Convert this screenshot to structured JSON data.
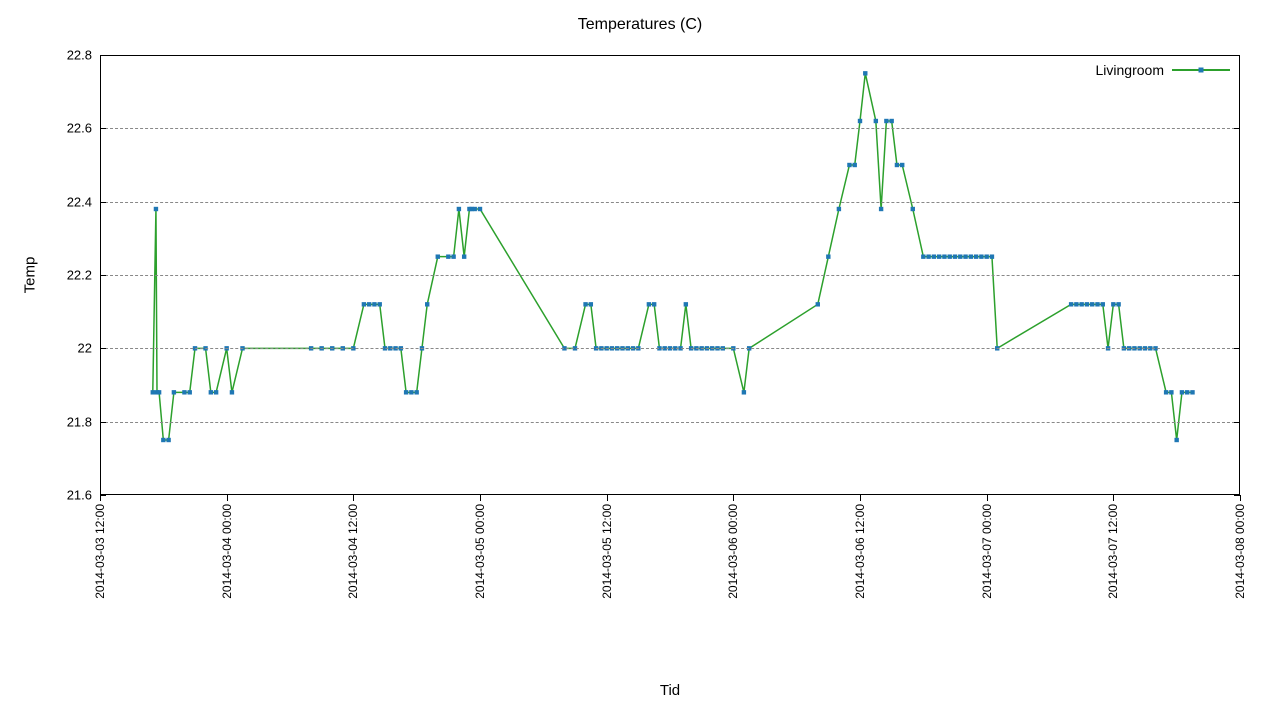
{
  "chart_data": {
    "type": "line",
    "title": "Temperatures (C)",
    "xlabel": "Tid",
    "ylabel": "Temp",
    "ylim": [
      21.6,
      22.8
    ],
    "xlim": [
      0,
      108
    ],
    "x_ticks": [
      {
        "pos": 0,
        "label": "2014-03-03 12:00"
      },
      {
        "pos": 12,
        "label": "2014-03-04 00:00"
      },
      {
        "pos": 24,
        "label": "2014-03-04 12:00"
      },
      {
        "pos": 36,
        "label": "2014-03-05 00:00"
      },
      {
        "pos": 48,
        "label": "2014-03-05 12:00"
      },
      {
        "pos": 60,
        "label": "2014-03-06 00:00"
      },
      {
        "pos": 72,
        "label": "2014-03-06 12:00"
      },
      {
        "pos": 84,
        "label": "2014-03-07 00:00"
      },
      {
        "pos": 96,
        "label": "2014-03-07 12:00"
      },
      {
        "pos": 108,
        "label": "2014-03-08 00:00"
      }
    ],
    "y_ticks": [
      21.6,
      21.8,
      22,
      22.2,
      22.4,
      22.6,
      22.8
    ],
    "series": [
      {
        "name": "Livingroom",
        "color_line": "#2ca02c",
        "color_marker": "#1f77b4",
        "x": [
          5.0,
          5.3,
          5.4,
          5.6,
          6.0,
          6.5,
          7.0,
          8.0,
          8.5,
          9.0,
          10.0,
          10.5,
          11.0,
          12.0,
          12.5,
          13.5,
          20.0,
          21.0,
          22.0,
          23.0,
          24.0,
          25.0,
          25.5,
          26.0,
          26.5,
          27.0,
          27.5,
          28.0,
          28.5,
          29.0,
          29.5,
          30.0,
          30.5,
          31.0,
          32.0,
          33.0,
          33.5,
          34.0,
          34.5,
          35.0,
          35.2,
          35.5,
          36.0,
          44.0,
          45.0,
          46.0,
          46.5,
          47.0,
          47.5,
          48.0,
          48.5,
          49.0,
          49.5,
          50.0,
          50.5,
          51.0,
          52.0,
          52.5,
          53.0,
          53.5,
          54.0,
          54.5,
          55.0,
          55.5,
          56.0,
          56.5,
          57.0,
          57.5,
          58.0,
          58.5,
          59.0,
          60.0,
          61.0,
          61.5,
          68.0,
          69.0,
          70.0,
          71.0,
          71.5,
          72.0,
          72.5,
          73.5,
          74.0,
          74.5,
          75.0,
          75.5,
          76.0,
          77.0,
          78.0,
          78.5,
          79.0,
          79.5,
          80.0,
          80.5,
          81.0,
          81.5,
          82.0,
          82.5,
          83.0,
          83.5,
          84.0,
          84.5,
          85.0,
          92.0,
          92.5,
          93.0,
          93.5,
          94.0,
          94.5,
          95.0,
          95.5,
          96.0,
          96.5,
          97.0,
          97.5,
          98.0,
          98.5,
          99.0,
          99.5,
          100.0,
          101.0,
          101.5,
          102.0,
          102.5,
          103.0,
          103.5
        ],
        "y": [
          21.88,
          22.38,
          21.88,
          21.88,
          21.75,
          21.75,
          21.88,
          21.88,
          21.88,
          22.0,
          22.0,
          21.88,
          21.88,
          22.0,
          21.88,
          22.0,
          22.0,
          22.0,
          22.0,
          22.0,
          22.0,
          22.12,
          22.12,
          22.12,
          22.12,
          22.0,
          22.0,
          22.0,
          22.0,
          21.88,
          21.88,
          21.88,
          22.0,
          22.12,
          22.25,
          22.25,
          22.25,
          22.38,
          22.25,
          22.38,
          22.38,
          22.38,
          22.38,
          22.0,
          22.0,
          22.12,
          22.12,
          22.0,
          22.0,
          22.0,
          22.0,
          22.0,
          22.0,
          22.0,
          22.0,
          22.0,
          22.12,
          22.12,
          22.0,
          22.0,
          22.0,
          22.0,
          22.0,
          22.12,
          22.0,
          22.0,
          22.0,
          22.0,
          22.0,
          22.0,
          22.0,
          22.0,
          21.88,
          22.0,
          22.12,
          22.25,
          22.38,
          22.5,
          22.5,
          22.62,
          22.75,
          22.62,
          22.38,
          22.62,
          22.62,
          22.5,
          22.5,
          22.38,
          22.25,
          22.25,
          22.25,
          22.25,
          22.25,
          22.25,
          22.25,
          22.25,
          22.25,
          22.25,
          22.25,
          22.25,
          22.25,
          22.25,
          22.0,
          22.12,
          22.12,
          22.12,
          22.12,
          22.12,
          22.12,
          22.12,
          22.0,
          22.12,
          22.12,
          22.0,
          22.0,
          22.0,
          22.0,
          22.0,
          22.0,
          22.0,
          21.88,
          21.88,
          21.75,
          21.88,
          21.88,
          21.88
        ]
      }
    ]
  }
}
